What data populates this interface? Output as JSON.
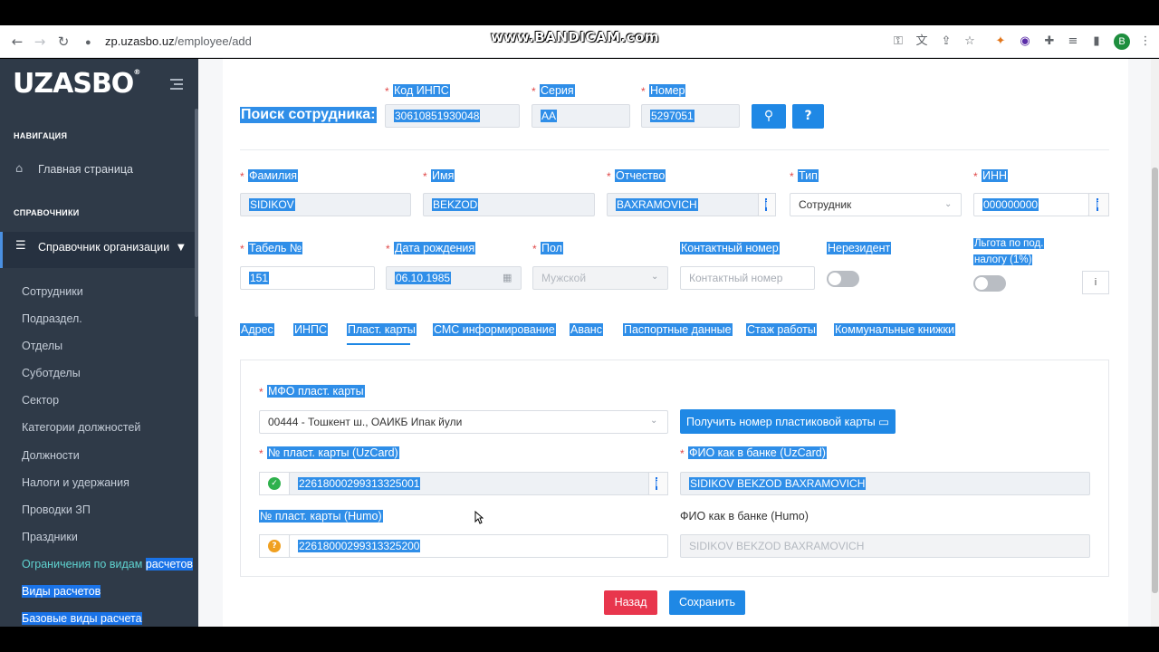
{
  "browser": {
    "url_host": "zp.uzasbo.uz",
    "url_path": "/employee/add",
    "avatar_letter": "B",
    "watermark": "www.BANDICAM.com"
  },
  "sidebar": {
    "logo": "UZASBO",
    "logo_mark": "®",
    "section_nav": "НАВИГАЦИЯ",
    "home": "Главная страница",
    "section_ref": "СПРАВОЧНИКИ",
    "org_ref": "Справочник организации",
    "items": [
      "Сотрудники",
      "Подраздел.",
      "Отделы",
      "Суботделы",
      "Сектор",
      "Категории должностей",
      "Должности",
      "Налоги и удержания",
      "Проводки ЗП",
      "Праздники"
    ],
    "item_limits_a": "Ограничения по видам",
    "item_limits_b": "расчетов",
    "item_calc_types": "Виды расчетов",
    "item_base_calc": "Базовые виды расчета"
  },
  "search": {
    "title": "Поиск сотрудника:",
    "inps_label": "Код ИНПС",
    "inps_value": "30610851930048",
    "series_label": "Серия",
    "series_value": "AA",
    "number_label": "Номер",
    "number_value": "5297051",
    "search_icon": "search-icon",
    "help_label": "?"
  },
  "form": {
    "lastname_label": "Фамилия",
    "lastname_value": "SIDIKOV",
    "firstname_label": "Имя",
    "firstname_value": "BEKZOD",
    "middlename_label": "Отчество",
    "middlename_value": "BAXRAMOVICH",
    "type_label": "Тип",
    "type_value": "Сотрудник",
    "inn_label": "ИНН",
    "inn_value": "000000000",
    "tabel_label": "Табель №",
    "tabel_value": "151",
    "birth_label": "Дата рождения",
    "birth_value": "06.10.1985",
    "gender_label": "Пол",
    "gender_value": "Мужской",
    "phone_label": "Контактный номер",
    "phone_placeholder": "Контактный номер",
    "nonresident_label": "Нерезидент",
    "benefit_label_1": "Льгота по под.",
    "benefit_label_2": "налогу (1%)",
    "info_i": "i"
  },
  "tabs": [
    "Адрес",
    "ИНПС",
    "Пласт. карты",
    "СМС информирование",
    "Аванс",
    "Паспортные данные",
    "Стаж работы",
    "Коммунальные книжки"
  ],
  "cards": {
    "mfo_label": "МФО пласт. карты",
    "mfo_value": "00444 - Тошкент ш., ОАИКБ Ипак йули",
    "get_card_button": "Получить номер пластиковой карты",
    "uzcard_label": "№ пласт. карты (UzCard)",
    "uzcard_value": "2261800029931332500​1",
    "uzcard_fio_label": "ФИО как в банке (UzCard)",
    "uzcard_fio_value": "SIDIKOV BEKZOD BAXRAMOVICH",
    "humo_label": "№ пласт. карты (Humo)",
    "humo_value": "22618000299313325200",
    "humo_fio_label": "ФИО как в банке (Humo)",
    "humo_fio_value": "SIDIKOV BEKZOD BAXRAMOVICH"
  },
  "actions": {
    "back": "Назад",
    "save": "Сохранить"
  },
  "colors": {
    "sidebar_bg": "#2f3a48",
    "accent": "#1f88e5",
    "danger": "#e8364d",
    "selection": "#2f8ee8"
  }
}
